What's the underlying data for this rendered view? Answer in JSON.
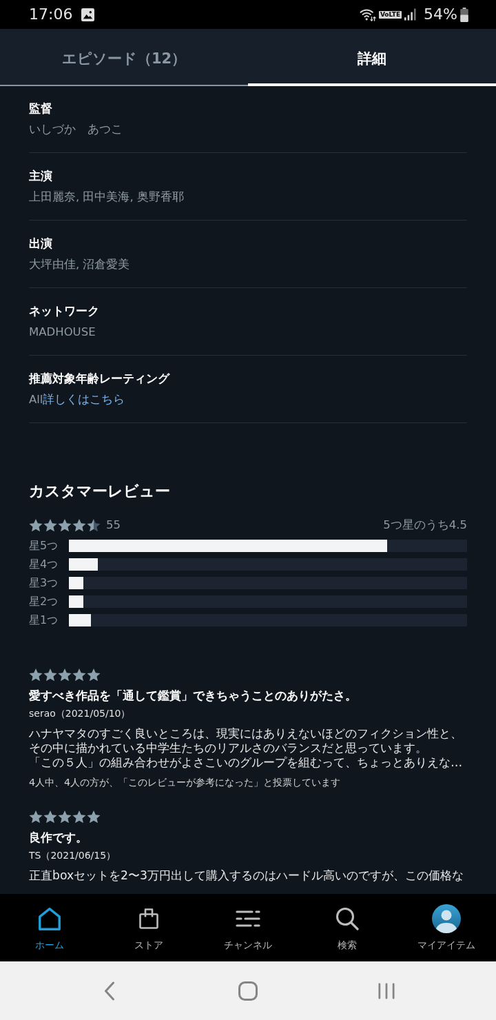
{
  "status_bar": {
    "time": "17:06",
    "network": "VoLTE",
    "battery": "54%"
  },
  "tabs": [
    {
      "label": "エピソード（12）",
      "selected": false
    },
    {
      "label": "詳細",
      "selected": true
    }
  ],
  "details": [
    {
      "label": "監督",
      "value": "いしづか　あつこ"
    },
    {
      "label": "主演",
      "value": "上田麗奈, 田中美海, 奥野香耶"
    },
    {
      "label": "出演",
      "value": "大坪由佳, 沼倉愛美"
    },
    {
      "label": "ネットワーク",
      "value": "MADHOUSE"
    },
    {
      "label": "推薦対象年齢レーティング",
      "value": "All",
      "link": "詳しくはこちら"
    }
  ],
  "reviews_summary": {
    "title": "カスタマーレビュー",
    "stars": 4.5,
    "count": "55",
    "average": "5つ星のうち4.5",
    "histogram": [
      {
        "label": "星5つ",
        "level": 0.8
      },
      {
        "label": "星4つ",
        "level": 0.073
      },
      {
        "label": "星3つ",
        "level": 0.036
      },
      {
        "label": "星2つ",
        "level": 0.036
      },
      {
        "label": "星1つ",
        "level": 0.055
      }
    ]
  },
  "reviews": [
    {
      "stars": 5,
      "title": "愛すべき作品を「通して鑑賞」できちゃうことのありがたさ。",
      "author": "serao（2021/05/10）",
      "paragraphs": [
        "ハナヤマタのすごく良いところは、現実にはありえないほどのフィクション性と、その中に描かれている中学生たちのリアルさのバランスだと思っています。",
        "「この５人」の組み合わせがよさこいのグループを組むって、ちょっとありえな…"
      ],
      "helpful": "4人中、4人の方が、「このレビューが参考になった」と投票しています"
    },
    {
      "stars": 5,
      "title": "良作です。",
      "author": "TS（2021/06/15）",
      "paragraphs": [
        "正直boxセットを2〜3万円出して購入するのはハードル高いのですが、この価格な"
      ]
    }
  ],
  "bottom_nav": [
    {
      "label": "ホーム",
      "selected": true
    },
    {
      "label": "ストア",
      "selected": false
    },
    {
      "label": "チャンネル",
      "selected": false
    },
    {
      "label": "検索",
      "selected": false
    },
    {
      "label": "マイアイテム",
      "selected": false
    }
  ]
}
